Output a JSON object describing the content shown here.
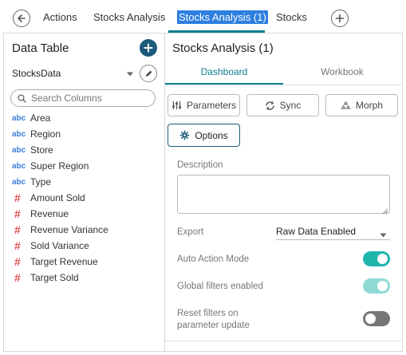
{
  "top_tabs": {
    "back_icon": "arrow-left-icon",
    "items": [
      {
        "label": "Actions"
      },
      {
        "label": "Stocks Analysis"
      },
      {
        "label": "Stocks Analysis (1)",
        "active": true
      },
      {
        "label": "Stocks"
      }
    ],
    "add_icon": "plus-icon",
    "accent_color": "#0d7f8f",
    "selection_color": "#2d7fe0"
  },
  "data_table": {
    "title": "Data Table",
    "add_icon": "plus-circle-icon",
    "source": "StocksData",
    "source_caret_icon": "caret-down-icon",
    "edit_icon": "pencil-icon",
    "search": {
      "placeholder": "Search Columns",
      "value": "",
      "icon": "search-icon"
    },
    "columns": [
      {
        "type": "abc",
        "name": "Area"
      },
      {
        "type": "abc",
        "name": "Region"
      },
      {
        "type": "abc",
        "name": "Store"
      },
      {
        "type": "abc",
        "name": "Super Region"
      },
      {
        "type": "abc",
        "name": "Type"
      },
      {
        "type": "#",
        "name": "Amount Sold"
      },
      {
        "type": "#",
        "name": "Revenue"
      },
      {
        "type": "#",
        "name": "Revenue Variance"
      },
      {
        "type": "#",
        "name": "Sold Variance"
      },
      {
        "type": "#",
        "name": "Target Revenue"
      },
      {
        "type": "#",
        "name": "Target Sold"
      }
    ],
    "text_type_color": "#3b7dd8",
    "numeric_type_color": "#d9534f"
  },
  "panel": {
    "title": "Stocks Analysis (1)",
    "tabs": {
      "dashboard": "Dashboard",
      "workbook": "Workbook",
      "active": "Dashboard"
    },
    "buttons": {
      "parameters": "Parameters",
      "sync": "Sync",
      "morph": "Morph",
      "options": "Options"
    },
    "description": {
      "label": "Description",
      "value": ""
    },
    "export": {
      "label": "Export",
      "value": "Raw Data Enabled"
    },
    "auto_action_mode": {
      "label": "Auto Action Mode",
      "on": true,
      "enabled": true
    },
    "global_filters": {
      "label": "Global filters enabled",
      "on": true,
      "enabled": false
    },
    "reset_filters": {
      "label_line1": "Reset filters on",
      "label_line2": "parameter update",
      "on": false,
      "enabled": true
    },
    "toggle_on_color": "#1fb5ad"
  }
}
